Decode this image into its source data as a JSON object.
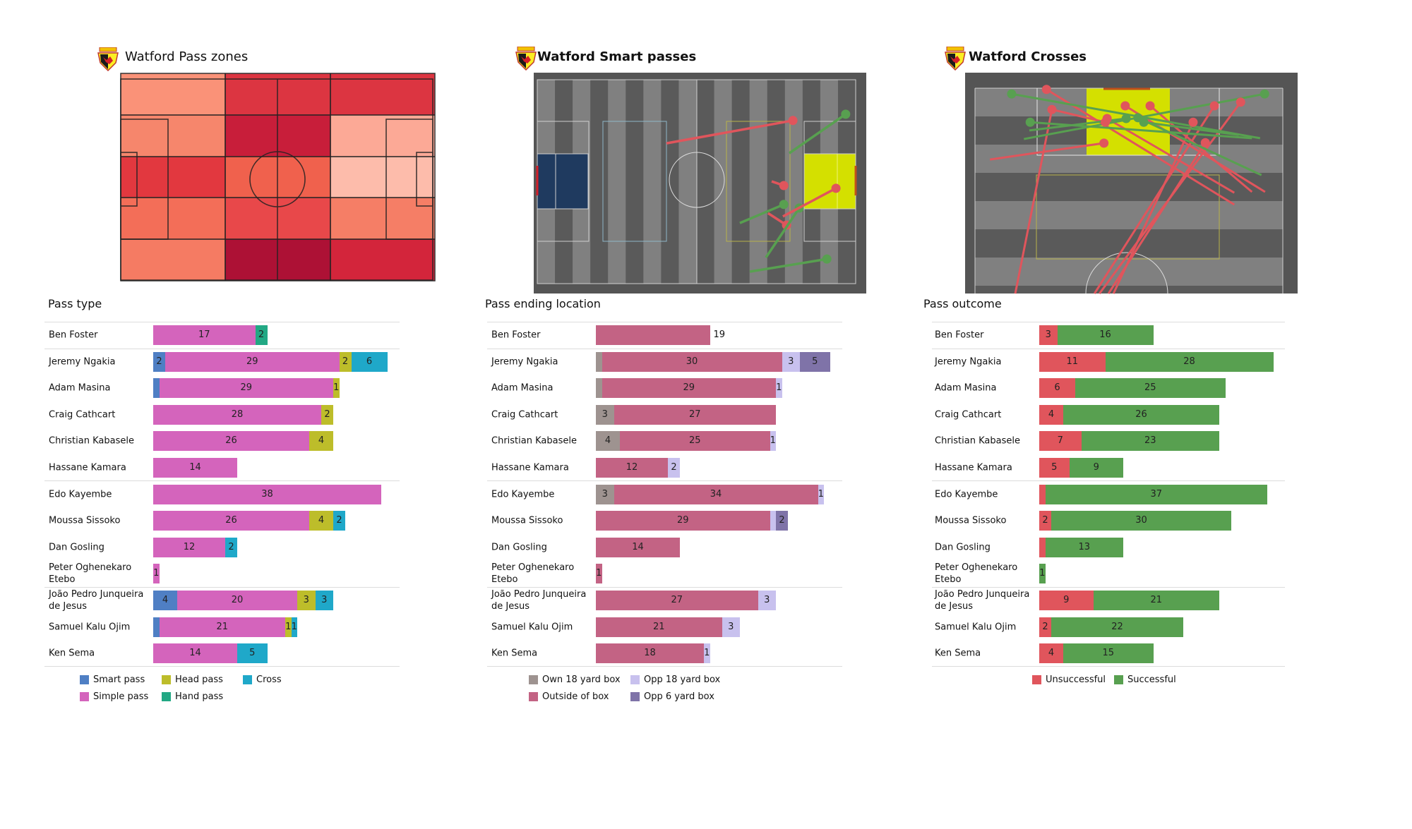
{
  "players": [
    "Ben Foster",
    "Jeremy Ngakia",
    "Adam Masina",
    "Craig Cathcart",
    "Christian Kabasele",
    "Hassane Kamara",
    "Edo Kayembe",
    "Moussa Sissoko",
    "Dan Gosling",
    "Peter Oghenekaro Etebo",
    "João Pedro Junqueira de Jesus",
    "Samuel Kalu Ojim",
    "Ken Sema"
  ],
  "titles": {
    "pass_zones": "Watford Pass zones",
    "smart_passes": "Watford Smart passes",
    "crosses": "Watford Crosses",
    "logo_text": "WATFORD"
  },
  "pass_zones": {
    "zone_colors": [
      [
        "#fa9278",
        "#dc3541",
        "#dc3541",
        "#dc3541"
      ],
      [
        "#f6866c",
        "#c81e3a",
        "#c81e3a",
        "#fca996"
      ],
      [
        "#e2383f",
        "#e2383f",
        "#f0614d",
        "#f0614d",
        "#fdbcab"
      ],
      [
        "#f36e58",
        "#e8484a",
        "#e8484a",
        "#f57e66"
      ],
      [
        "#f57b63",
        "#ad1135",
        "#ad1135",
        "#d3253b"
      ]
    ]
  },
  "smart_passes": [
    {
      "from": [
        42.6,
        21.2
      ],
      "to": [
        84.3,
        13.6
      ],
      "outcome": "unsuccessful"
    },
    {
      "from": [
        83.1,
        24.5
      ],
      "to": [
        101.7,
        11.5
      ],
      "outcome": "successful"
    },
    {
      "from": [
        77.3,
        33.9
      ],
      "to": [
        81.3,
        35.3
      ],
      "outcome": "unsuccessful"
    },
    {
      "from": [
        66.8,
        47.8
      ],
      "to": [
        81.3,
        41.6
      ],
      "outcome": "successful"
    },
    {
      "from": [
        76.1,
        44.5
      ],
      "to": [
        82.2,
        48.5
      ],
      "outcome": "unsuccessful"
    },
    {
      "from": [
        75.4,
        59.3
      ],
      "to": [
        86.4,
        42.8
      ],
      "outcome": "successful"
    },
    {
      "from": [
        81.0,
        45.6
      ],
      "to": [
        98.5,
        36.2
      ],
      "outcome": "unsuccessful"
    },
    {
      "from": [
        70.1,
        64.0
      ],
      "to": [
        95.5,
        59.8
      ],
      "outcome": "successful"
    }
  ],
  "crosses": [
    {
      "from": [
        76.6,
        57.3
      ],
      "to": [
        104.7,
        15.8
      ],
      "outcome": "unsuccessful"
    },
    {
      "from": [
        79.7,
        64.1
      ],
      "to": [
        100.7,
        33.2
      ],
      "outcome": "unsuccessful"
    },
    {
      "from": [
        79.7,
        61.2
      ],
      "to": [
        100.7,
        38.7
      ],
      "outcome": "unsuccessful"
    },
    {
      "from": [
        79.5,
        57.3
      ],
      "to": [
        97.6,
        29.2
      ],
      "outcome": "unsuccessful"
    },
    {
      "from": [
        99.8,
        17.0
      ],
      "to": [
        96.7,
        28.8
      ],
      "outcome": "unsuccessful"
    },
    {
      "from": [
        54.9,
        8.9
      ],
      "to": [
        99.8,
        17.0
      ],
      "outcome": "unsuccessful"
    },
    {
      "from": [
        87.6,
        3.3
      ],
      "to": [
        91.6,
        28.5
      ],
      "outcome": "unsuccessful"
    },
    {
      "from": [
        54.9,
        26.4
      ],
      "to": [
        100.7,
        52.9
      ],
      "outcome": "unsuccessful"
    },
    {
      "from": [
        54.9,
        27.5
      ],
      "to": [
        101.6,
        58.7
      ],
      "outcome": "unsuccessful"
    },
    {
      "from": [
        54.9,
        29.5
      ],
      "to": [
        91.7,
        50.9
      ],
      "outcome": "unsuccessful"
    },
    {
      "from": [
        54.9,
        30.6
      ],
      "to": [
        96.7,
        48.2
      ],
      "outcome": "unsuccessful"
    },
    {
      "from": [
        92.8,
        63.0
      ],
      "to": [
        103.6,
        8.1
      ],
      "outcome": "successful"
    },
    {
      "from": [
        92.6,
        10.8
      ],
      "to": [
        103.6,
        64.0
      ],
      "outcome": "successful"
    },
    {
      "from": [
        92.8,
        61.2
      ],
      "to": [
        96.7,
        12.2
      ],
      "outcome": "successful"
    },
    {
      "from": [
        94.7,
        12.0
      ],
      "to": [
        97.6,
        33.4
      ],
      "outcome": "successful"
    },
    {
      "from": [
        83.8,
        63.3
      ],
      "to": [
        97.8,
        36.0
      ],
      "outcome": "successful"
    },
    {
      "from": [
        93.6,
        58.3
      ],
      "to": [
        96.7,
        37.3
      ],
      "outcome": "successful"
    }
  ],
  "outcome_colors": {
    "successful": "#58a050",
    "unsuccessful": "#e0555c"
  },
  "chart_data": [
    {
      "type": "bar",
      "orientation": "horizontal-stacked",
      "title": "Pass type",
      "categories": [
        "Ben Foster",
        "Jeremy Ngakia",
        "Adam Masina",
        "Craig Cathcart",
        "Christian Kabasele",
        "Hassane Kamara",
        "Edo Kayembe",
        "Moussa Sissoko",
        "Dan Gosling",
        "Peter Oghenekaro Etebo",
        "João Pedro Junqueira de Jesus",
        "Samuel Kalu Ojim",
        "Ken Sema"
      ],
      "series": [
        {
          "name": "Smart pass",
          "color": "#4f7fc4",
          "values": [
            0,
            2,
            1,
            0,
            0,
            0,
            0,
            0,
            0,
            0,
            4,
            1,
            0
          ],
          "labels": [
            "",
            "2",
            "",
            "",
            "",
            "",
            "",
            "",
            "",
            "",
            "4",
            "",
            ""
          ]
        },
        {
          "name": "Simple pass",
          "color": "#d464bc",
          "values": [
            17,
            29,
            29,
            28,
            26,
            14,
            38,
            26,
            12,
            1,
            20,
            21,
            14
          ],
          "labels": [
            "17",
            "29",
            "29",
            "28",
            "26",
            "14",
            "38",
            "26",
            "12",
            "1",
            "20",
            "21",
            "14"
          ]
        },
        {
          "name": "Head pass",
          "color": "#bdbd2a",
          "values": [
            0,
            2,
            1,
            2,
            4,
            0,
            0,
            4,
            0,
            0,
            3,
            1,
            0
          ],
          "labels": [
            "",
            "2",
            "1",
            "2",
            "4",
            "",
            "",
            "4",
            "",
            "",
            "3",
            "1",
            ""
          ]
        },
        {
          "name": "Hand pass",
          "color": "#22a884",
          "values": [
            2,
            0,
            0,
            0,
            0,
            0,
            0,
            0,
            0,
            0,
            0,
            0,
            0
          ],
          "labels": [
            "2",
            "",
            "",
            "",
            "",
            "",
            "",
            "",
            "",
            "",
            "",
            "",
            ""
          ]
        },
        {
          "name": "Cross",
          "color": "#1fa8c9",
          "values": [
            0,
            6,
            0,
            0,
            0,
            0,
            0,
            2,
            2,
            0,
            3,
            1,
            5
          ],
          "labels": [
            "",
            "6",
            "",
            "",
            "",
            "",
            "",
            "2",
            "2",
            "",
            "3",
            "1",
            "5"
          ]
        }
      ],
      "legend_rows": [
        [
          "Smart pass",
          "Head pass",
          "Cross"
        ],
        [
          "Simple pass",
          "Hand pass"
        ]
      ],
      "outside_labels": [
        "",
        "",
        "",
        "",
        "",
        "",
        "",
        "",
        "",
        "",
        "",
        "",
        ""
      ]
    },
    {
      "type": "bar",
      "orientation": "horizontal-stacked",
      "title": "Pass ending location",
      "categories": [
        "Ben Foster",
        "Jeremy Ngakia",
        "Adam Masina",
        "Craig Cathcart",
        "Christian Kabasele",
        "Hassane Kamara",
        "Edo Kayembe",
        "Moussa Sissoko",
        "Dan Gosling",
        "Peter Oghenekaro Etebo",
        "João Pedro Junqueira de Jesus",
        "Samuel Kalu Ojim",
        "Ken Sema"
      ],
      "series": [
        {
          "name": "Own 18 yard box",
          "color": "#9e9390",
          "values": [
            0,
            1,
            1,
            3,
            4,
            0,
            3,
            0,
            0,
            0,
            0,
            0,
            0
          ],
          "labels": [
            "",
            "",
            "",
            "3",
            "4",
            "",
            "3",
            "",
            "",
            "",
            "",
            "",
            ""
          ]
        },
        {
          "name": "Outside of box",
          "color": "#c36384",
          "values": [
            19,
            30,
            29,
            27,
            25,
            12,
            34,
            29,
            14,
            1,
            27,
            21,
            18
          ],
          "labels": [
            "",
            "30",
            "29",
            "27",
            "25",
            "12",
            "34",
            "29",
            "14",
            "1",
            "27",
            "21",
            "18"
          ]
        },
        {
          "name": "Opp 18 yard box",
          "color": "#c8c1ee",
          "values": [
            0,
            3,
            1,
            0,
            1,
            2,
            1,
            1,
            0,
            0,
            3,
            3,
            1
          ],
          "labels": [
            "",
            "3",
            "1",
            "",
            "1",
            "2",
            "1",
            "",
            "",
            "",
            "3",
            "3",
            "1"
          ]
        },
        {
          "name": "Opp 6 yard box",
          "color": "#7f73a8",
          "values": [
            0,
            5,
            0,
            0,
            0,
            0,
            0,
            2,
            0,
            0,
            0,
            0,
            0
          ],
          "labels": [
            "",
            "5",
            "",
            "",
            "",
            "",
            "",
            "2",
            "",
            "",
            "",
            "",
            ""
          ]
        }
      ],
      "legend_rows": [
        [
          "Own 18 yard box",
          "Opp 18 yard box"
        ],
        [
          "Outside of box",
          "Opp 6 yard box"
        ]
      ],
      "outside_labels": [
        "19",
        "",
        "",
        "",
        "",
        "",
        "",
        "",
        "",
        "",
        "",
        "",
        ""
      ]
    },
    {
      "type": "bar",
      "orientation": "horizontal-stacked",
      "title": "Pass outcome",
      "categories": [
        "Ben Foster",
        "Jeremy Ngakia",
        "Adam Masina",
        "Craig Cathcart",
        "Christian Kabasele",
        "Hassane Kamara",
        "Edo Kayembe",
        "Moussa Sissoko",
        "Dan Gosling",
        "Peter Oghenekaro Etebo",
        "João Pedro Junqueira de Jesus",
        "Samuel Kalu Ojim",
        "Ken Sema"
      ],
      "series": [
        {
          "name": "Unsuccessful",
          "color": "#e0555c",
          "values": [
            3,
            11,
            6,
            4,
            7,
            5,
            1,
            2,
            1,
            0,
            9,
            2,
            4
          ],
          "labels": [
            "3",
            "11",
            "6",
            "4",
            "7",
            "5",
            "",
            "2",
            "",
            "",
            "9",
            "2",
            "4"
          ]
        },
        {
          "name": "Successful",
          "color": "#58a050",
          "values": [
            16,
            28,
            25,
            26,
            23,
            9,
            37,
            30,
            13,
            1,
            21,
            22,
            15
          ],
          "labels": [
            "16",
            "28",
            "25",
            "26",
            "23",
            "9",
            "37",
            "30",
            "13",
            "1",
            "21",
            "22",
            "15"
          ]
        }
      ],
      "legend_rows": [
        [
          "Unsuccessful",
          "Successful"
        ]
      ],
      "outside_labels": [
        "",
        "",
        "",
        "",
        "",
        "",
        "",
        "",
        "",
        "",
        "",
        "",
        ""
      ]
    }
  ]
}
